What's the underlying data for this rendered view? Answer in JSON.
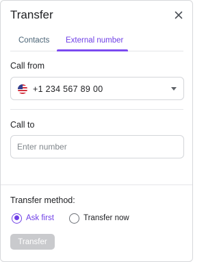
{
  "dialog": {
    "title": "Transfer",
    "close_icon": "close-icon"
  },
  "tabs": [
    {
      "label": "Contacts",
      "active": false
    },
    {
      "label": "External number",
      "active": true
    }
  ],
  "call_from": {
    "label": "Call from",
    "flag_icon": "us-flag-icon",
    "value": "+1 234 567 89 00",
    "dropdown_icon": "caret-down-icon"
  },
  "call_to": {
    "label": "Call to",
    "placeholder": "Enter number",
    "value": ""
  },
  "transfer_method": {
    "label": "Transfer method:",
    "options": [
      {
        "label": "Ask first",
        "selected": true
      },
      {
        "label": "Transfer now",
        "selected": false
      }
    ]
  },
  "actions": {
    "transfer_label": "Transfer",
    "transfer_enabled": false
  },
  "colors": {
    "accent": "#6f3fe6",
    "disabled_button": "#c9cacd",
    "border": "#d3d5d9"
  }
}
